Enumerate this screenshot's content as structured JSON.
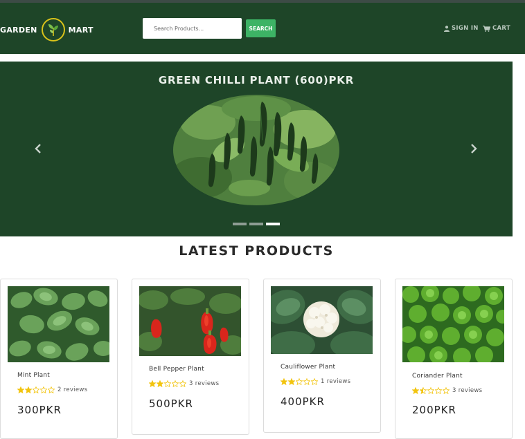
{
  "header": {
    "brand_left": "GARDEN",
    "brand_right": "MART",
    "search_placeholder": "Search Products...",
    "search_button": "SEARCH",
    "sign_in": "SIGN IN",
    "cart": "CART"
  },
  "carousel": {
    "title": "GREEN CHILLI PLANT (600)PKR",
    "slide_count": 3,
    "active_slide": 3
  },
  "section": {
    "title": "LATEST PRODUCTS"
  },
  "products": [
    {
      "name": "Mint Plant",
      "rating": 2,
      "reviews": "2 reviews",
      "price": "300PKR"
    },
    {
      "name": "Bell Pepper Plant",
      "rating": 2,
      "reviews": "3 reviews",
      "price": "500PKR"
    },
    {
      "name": "Cauliflower Plant",
      "rating": 2,
      "reviews": "1 reviews",
      "price": "400PKR"
    },
    {
      "name": "Coriander Plant",
      "rating": 1.5,
      "reviews": "3 reviews",
      "price": "200PKR"
    }
  ],
  "colors": {
    "brand_green": "#1e4528",
    "search_button": "#3db365",
    "star": "#f2c40f"
  },
  "icons": [
    "leaf-logo-icon",
    "user-icon",
    "cart-icon",
    "chevron-left-icon",
    "chevron-right-icon",
    "star-icon"
  ]
}
